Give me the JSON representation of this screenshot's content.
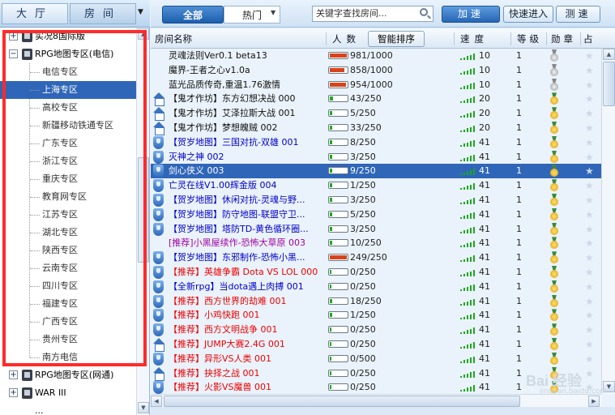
{
  "left_panel": {
    "tabs": [
      {
        "label": "大厅"
      },
      {
        "label": "房间"
      }
    ],
    "tree": [
      {
        "label": "实况8国际版",
        "expanded": false
      },
      {
        "label": "RPG地图专区(电信)",
        "expanded": true
      },
      {
        "label": "RPG地图专区(网通)",
        "expanded": false
      },
      {
        "label": "WAR III",
        "expanded": false
      },
      {
        "label": "..."
      }
    ],
    "children": [
      "电信专区",
      "上海专区",
      "高校专区",
      "新疆移动铁通专区",
      "广东专区",
      "浙江专区",
      "重庆专区",
      "教育网专区",
      "江苏专区",
      "湖北专区",
      "陕西专区",
      "云南专区",
      "四川专区",
      "福建专区",
      "广西专区",
      "贵州专区",
      "南方电信"
    ],
    "selected_child": "上海专区"
  },
  "toolbar": {
    "tab_all": "全部",
    "tab_hot": "热门",
    "search_placeholder": "关键字查找房间...",
    "btn_speed": "加速",
    "btn_quick": "快速进入",
    "btn_test": "测速"
  },
  "header": {
    "room_name": "房间名称",
    "people": "人数",
    "smart_sort": "智能排序",
    "speed": "速度",
    "level": "等级",
    "medal": "勋章",
    "extra": "占"
  },
  "rows": [
    {
      "name": "灵魂法则Ver0.1 beta13",
      "color": "c-black",
      "icon": "none",
      "count": "981/1000",
      "fill": 0.98,
      "speed": "10",
      "level": "1",
      "medal": "silver"
    },
    {
      "name": "魔界-王者之心v1.0a",
      "color": "c-black",
      "icon": "none",
      "count": "858/1000",
      "fill": 0.86,
      "speed": "10",
      "level": "1",
      "medal": "silver"
    },
    {
      "name": "蓝光品质传奇,重温1.76激情",
      "color": "c-black",
      "icon": "none",
      "count": "954/1000",
      "fill": 0.95,
      "speed": "10",
      "level": "1",
      "medal": "silver"
    },
    {
      "name": "【鬼才作坊】东方幻想决战 000",
      "color": "c-black",
      "icon": "house",
      "count": "43/250",
      "fill": 0.17,
      "speed": "20",
      "level": "1",
      "medal": "gold"
    },
    {
      "name": "【鬼才作坊】艾泽拉斯大战 001",
      "color": "c-black",
      "icon": "house",
      "count": "5/250",
      "fill": 0.02,
      "speed": "20",
      "level": "1",
      "medal": "gold"
    },
    {
      "name": "【鬼才作坊】梦想魄贼 002",
      "color": "c-black",
      "icon": "house",
      "count": "33/250",
      "fill": 0.13,
      "speed": "20",
      "level": "1",
      "medal": "gold"
    },
    {
      "name": "【贺岁地图】三国对抗-双雄 001",
      "color": "c-blue",
      "icon": "shield",
      "count": "8/250",
      "fill": 0.03,
      "speed": "41",
      "level": "1",
      "medal": "gold"
    },
    {
      "name": "灭神之神 002",
      "color": "c-blue",
      "icon": "shield",
      "count": "3/250",
      "fill": 0.01,
      "speed": "41",
      "level": "1",
      "medal": "gold"
    },
    {
      "name": "剑心侠义 003",
      "color": "c-blue",
      "icon": "shield",
      "count": "9/250",
      "fill": 0.04,
      "speed": "41",
      "level": "1",
      "medal": "gold",
      "selected": true
    },
    {
      "name": "亡灵在线V1.00辉金版 004",
      "color": "c-blue",
      "icon": "shield",
      "count": "1/250",
      "fill": 0.01,
      "speed": "41",
      "level": "1",
      "medal": "gold"
    },
    {
      "name": "【贺岁地图】休闲对抗-灵魂与野...",
      "color": "c-blue",
      "icon": "shield",
      "count": "3/250",
      "fill": 0.01,
      "speed": "41",
      "level": "1",
      "medal": "gold"
    },
    {
      "name": "【贺岁地图】防守地图-联盟守卫...",
      "color": "c-blue",
      "icon": "shield",
      "count": "5/250",
      "fill": 0.02,
      "speed": "41",
      "level": "1",
      "medal": "gold"
    },
    {
      "name": "【贺岁地图】塔防TD-黄色循环圈...",
      "color": "c-blue",
      "icon": "shield",
      "count": "3/250",
      "fill": 0.01,
      "speed": "41",
      "level": "1",
      "medal": "gold"
    },
    {
      "name": "[推荐]小黑屋续作-恐怖大草原 003",
      "color": "c-purple",
      "icon": "none",
      "count": "10/250",
      "fill": 0.04,
      "speed": "41",
      "level": "1",
      "medal": "gold"
    },
    {
      "name": "【贺岁地图】东邪制作-恐怖小黑...",
      "color": "c-blue",
      "icon": "shield",
      "count": "249/250",
      "fill": 1.0,
      "speed": "41",
      "level": "1",
      "medal": "gold"
    },
    {
      "name": "【推荐】英雄争霸 Dota VS LOL 000",
      "color": "c-red",
      "icon": "shield",
      "count": "0/250",
      "fill": 0.0,
      "speed": "41",
      "level": "1",
      "medal": "gold"
    },
    {
      "name": "【全新rpg】当dota遇上肉搏 001",
      "color": "c-blue",
      "icon": "shield",
      "count": "0/250",
      "fill": 0.0,
      "speed": "41",
      "level": "1",
      "medal": "gold"
    },
    {
      "name": "【推荐】西方世界的劫难 001",
      "color": "c-red",
      "icon": "shield",
      "count": "18/250",
      "fill": 0.07,
      "speed": "41",
      "level": "1",
      "medal": "gold"
    },
    {
      "name": "【推荐】小鸡快跑 001",
      "color": "c-red",
      "icon": "shield",
      "count": "1/250",
      "fill": 0.01,
      "speed": "41",
      "level": "1",
      "medal": "gold"
    },
    {
      "name": "【推荐】西方文明战争 001",
      "color": "c-red",
      "icon": "shield",
      "count": "0/250",
      "fill": 0.0,
      "speed": "41",
      "level": "1",
      "medal": "gold"
    },
    {
      "name": "【推荐】JUMP大赛2.4G 001",
      "color": "c-red",
      "icon": "house",
      "count": "0/250",
      "fill": 0.0,
      "speed": "41",
      "level": "1",
      "medal": "gold"
    },
    {
      "name": "【推荐】异形VS人类 001",
      "color": "c-red",
      "icon": "shield",
      "count": "0/500",
      "fill": 0.0,
      "speed": "41",
      "level": "1",
      "medal": "gold"
    },
    {
      "name": "【推荐】抉择之战 001",
      "color": "c-red",
      "icon": "house",
      "count": "0/250",
      "fill": 0.0,
      "speed": "41",
      "level": "1",
      "medal": "gold"
    },
    {
      "name": "【推荐】火影VS魔兽 001",
      "color": "c-red",
      "icon": "shield",
      "count": "0/250",
      "fill": 0.0,
      "speed": "41",
      "level": "1",
      "medal": "gold"
    }
  ],
  "watermark": {
    "text": "Bai 经验",
    "url": "jingyan.baidu.com"
  },
  "colors": {
    "selection": "#2f66b8",
    "highlight_frame": "#ff2b2b",
    "accent": "#1b5fae"
  }
}
